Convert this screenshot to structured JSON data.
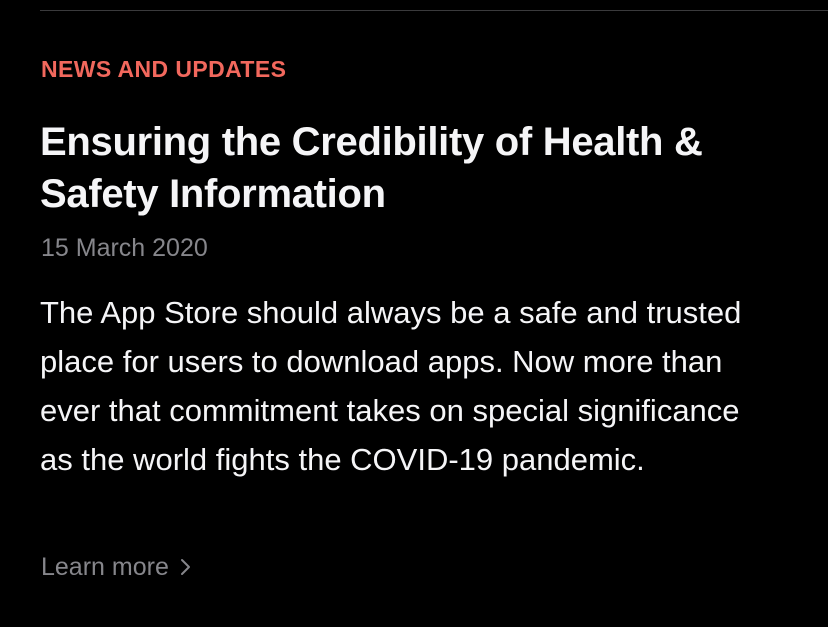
{
  "article": {
    "category": "NEWS AND UPDATES",
    "title": "Ensuring the Credibility of Health & Safety Information",
    "date": "15 March 2020",
    "body": "The App Store should always be a safe and trusted place for users to download apps. Now more than ever that commitment takes on special significance as the world fights the COVID-19 pandemic.",
    "link_label": "Learn more"
  },
  "colors": {
    "background": "#000000",
    "category": "#f2685d",
    "text": "#f5f5f7",
    "secondary": "#86868b"
  },
  "icons": {
    "link_chevron": "chevron-right-icon"
  }
}
